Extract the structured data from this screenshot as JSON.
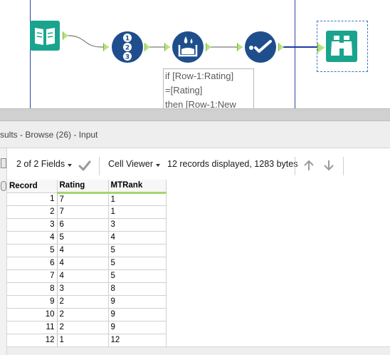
{
  "annotation": {
    "line1": "if [Row-1:Rating]",
    "line2": "=[Rating]",
    "line3": "then [Row-1:New"
  },
  "results": {
    "title": "sults - Browse (26) - Input"
  },
  "toolbar": {
    "fields": "2 of 2 Fields",
    "viewer": "Cell Viewer",
    "status": "12 records displayed, 1283 bytes"
  },
  "table": {
    "headers": [
      "Record",
      "Rating",
      "MTRank"
    ],
    "rows": [
      [
        "1",
        "7",
        "1"
      ],
      [
        "2",
        "7",
        "1"
      ],
      [
        "3",
        "6",
        "3"
      ],
      [
        "4",
        "5",
        "4"
      ],
      [
        "5",
        "4",
        "5"
      ],
      [
        "6",
        "4",
        "5"
      ],
      [
        "7",
        "4",
        "5"
      ],
      [
        "8",
        "3",
        "8"
      ],
      [
        "9",
        "2",
        "9"
      ],
      [
        "10",
        "2",
        "9"
      ],
      [
        "11",
        "2",
        "9"
      ],
      [
        "12",
        "1",
        "12"
      ]
    ]
  },
  "colors": {
    "tool_teal": "#1aa48e",
    "tool_blue": "#1f4e8c",
    "anchor_green": "#b5e37a",
    "metric_underline": "#9fd86d"
  },
  "icons": {
    "input": "book-input-icon",
    "record_id": "numbered-list-icon",
    "multi_row": "multi-row-formula-icon",
    "select": "check-select-icon",
    "browse": "binoculars-icon",
    "apply": "checkmark-icon",
    "sort_up": "arrow-up-icon",
    "sort_down": "arrow-down-icon"
  }
}
